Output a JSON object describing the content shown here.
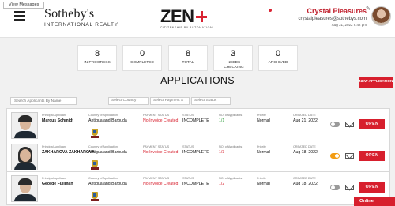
{
  "header": {
    "view_messages": "View Messages",
    "brand_top": "Sotheby's",
    "brand_sub": "INTERNATIONAL REALTY",
    "logo_word": "ZEN",
    "logo_tag": "CITIZENSHIP BY AUTOMATION",
    "user_name": "Crystal Pleasures",
    "user_email": "crystalpleasures@sothebys.com",
    "user_date": "Aug 31, 2022 9:42 pm",
    "icons": [
      "hamburger-menu-icon",
      "notification-dot-icon",
      "pencil-icon",
      "avatar"
    ]
  },
  "stats": [
    {
      "value": "8",
      "label": "IN PROGRESS"
    },
    {
      "value": "0",
      "label": "COMPLETED"
    },
    {
      "value": "8",
      "label": "TOTAL"
    },
    {
      "value": "3",
      "label": "NEEDS CHECKING"
    },
    {
      "value": "0",
      "label": "ARCHIVED"
    }
  ],
  "page": {
    "title": "APPLICATIONS",
    "new_button": "NEW APPLICATION"
  },
  "filters": {
    "search_placeholder": "Search Applicants By Name",
    "country": "Select Country",
    "payment": "Select Payment S",
    "status": "Select Status"
  },
  "columns": {
    "principal": "Principal Applicant",
    "country": "Country of Application",
    "payment": "PAYMENT STATUS",
    "status": "STATUS",
    "count": "NO. of Applicants",
    "priority": "Priority",
    "created": "CREATED DATE"
  },
  "rows": [
    {
      "name": "Marcus Schmidt",
      "country": "Antigua and Barbuda",
      "payment": "No Invoice Created",
      "status": "INCOMPLETE",
      "count": "1/1",
      "count_color": "#2e9e3b",
      "priority": "Normal",
      "created": "Aug 21, 2022",
      "toggle": "off",
      "open": "OPEN"
    },
    {
      "name": "ZAKHAROVA ZAKHAROVA",
      "country": "Antigua and Barbuda",
      "payment": "No Invoice Created",
      "status": "INCOMPLETE",
      "count": "1/3",
      "count_color": "#d71f2d",
      "priority": "Normal",
      "created": "Aug 18, 2022",
      "toggle": "on",
      "open": "OPEN"
    },
    {
      "name": "George Fullman",
      "country": "Antigua and Barbuda",
      "payment": "No Invoice Created",
      "status": "INCOMPLETE",
      "count": "1/2",
      "count_color": "#d71f2d",
      "priority": "Normal",
      "created": "Aug 18, 2022",
      "toggle": "off",
      "open": "OPEN"
    }
  ],
  "chat": {
    "label": "Online"
  },
  "colors": {
    "accent": "#d71f2d",
    "toggle_on": "#f39c12"
  }
}
